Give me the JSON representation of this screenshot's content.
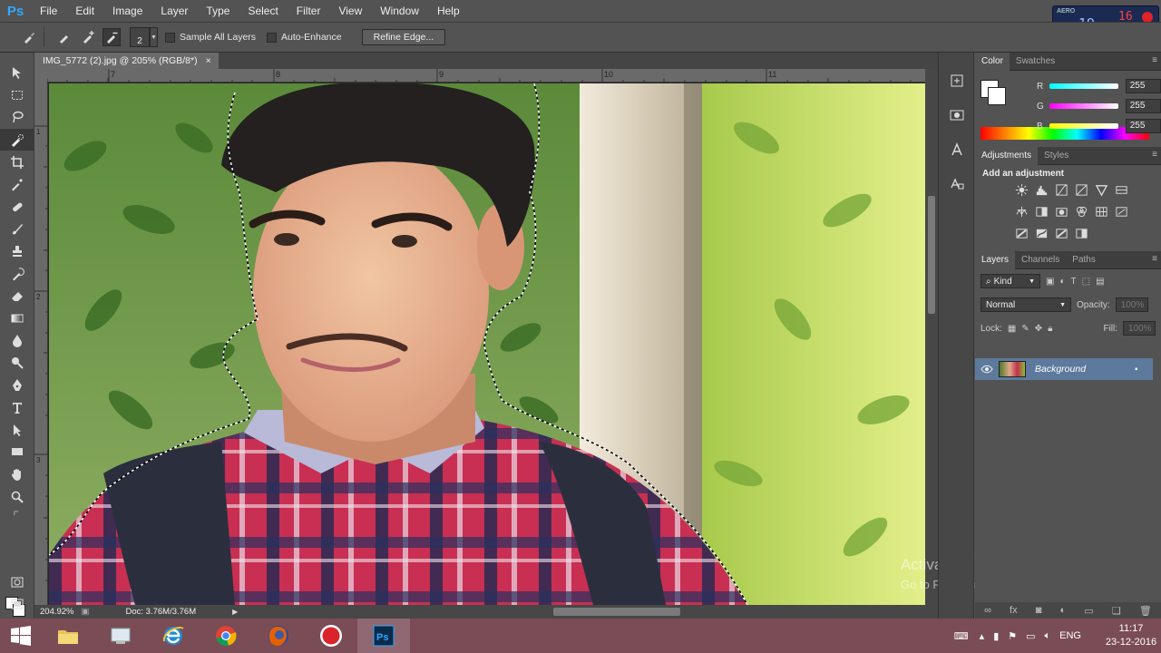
{
  "menubar": {
    "logo": "Ps",
    "items": [
      "File",
      "Edit",
      "Image",
      "Layer",
      "Type",
      "Select",
      "Filter",
      "View",
      "Window",
      "Help"
    ]
  },
  "options": {
    "brush_size": "2",
    "sample_all_layers": "Sample All Layers",
    "auto_enhance": "Auto-Enhance",
    "refine_edge": "Refine Edge..."
  },
  "perf_widget": {
    "label": "AERO",
    "num_big": "19",
    "num_red": "16"
  },
  "document": {
    "tab_title": "IMG_5772 (2).jpg @ 205% (RGB/8*)",
    "close": "×",
    "ruler_top": [
      "7",
      "8",
      "9",
      "10",
      "11"
    ],
    "ruler_left": [
      "1",
      "2",
      "3"
    ],
    "zoom": "204.92%",
    "doc_size": "Doc: 3.76M/3.76M"
  },
  "panels": {
    "color_tabs": [
      "Color",
      "Swatches"
    ],
    "channels": [
      {
        "label": "R",
        "value": "255",
        "color": "linear-gradient(90deg,#00ffff,#ffffff)"
      },
      {
        "label": "G",
        "value": "255",
        "color": "linear-gradient(90deg,#ff00ff,#ffffff)"
      },
      {
        "label": "B",
        "value": "255",
        "color": "linear-gradient(90deg,#ffff00,#ffffff)"
      }
    ],
    "adj_tabs": [
      "Adjustments",
      "Styles"
    ],
    "add_adjustment": "Add an adjustment",
    "layer_tabs": [
      "Layers",
      "Channels",
      "Paths"
    ],
    "kind": "Kind",
    "blend_mode": "Normal",
    "opacity_label": "Opacity:",
    "opacity_value": "100%",
    "lock_label": "Lock:",
    "fill_label": "Fill:",
    "fill_value": "100%",
    "layer_name": "Background"
  },
  "watermark": {
    "line1": "Activate Windows",
    "line2": "Go to PC settings to activate Windows."
  },
  "taskbar": {
    "language": "ENG",
    "time": "11:17",
    "date": "23-12-2016"
  }
}
